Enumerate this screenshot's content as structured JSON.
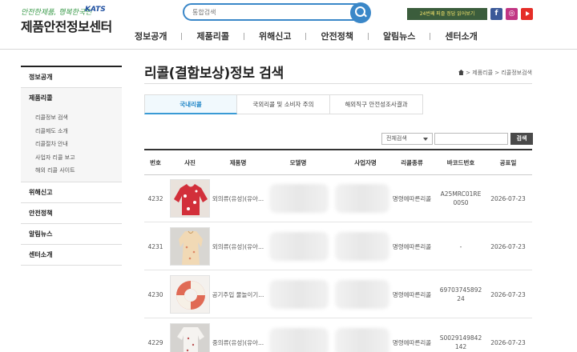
{
  "header": {
    "slogan": "안전한제품, 행복한국민",
    "kats_logo": "KATS",
    "site_title": "제품안전정보센터",
    "search_placeholder": "통합검색",
    "banner_text": "24번째 퍼즐 정답 읽어보기",
    "sns": [
      {
        "name": "facebook-icon"
      },
      {
        "name": "instagram-icon"
      },
      {
        "name": "youtube-icon"
      }
    ]
  },
  "gnb": [
    "정보공개",
    "제품리콜",
    "위해신고",
    "안전정책",
    "알림뉴스",
    "센터소개"
  ],
  "lnb": {
    "menus": [
      "정보공개",
      "제품리콜",
      "위해신고",
      "안전정책",
      "알림뉴스",
      "센터소개"
    ],
    "active": "제품리콜",
    "sub": [
      "리콜정보 검색",
      "리콜제도 소개",
      "리콜절차 안내",
      "사업자 리콜 보고",
      "해외 리콜 사이트"
    ]
  },
  "page_title": "리콜(결함보상)정보 검색",
  "breadcrumb": [
    "제품리콜",
    "리콜정보검색"
  ],
  "tabs": [
    "국내리콜",
    "국외리콜 및 소비자 주의",
    "해외직구 안전성조사결과"
  ],
  "active_tab": 0,
  "search": {
    "select_value": "전체검색",
    "button": "검색"
  },
  "table": {
    "headers": [
      "번호",
      "사진",
      "제품명",
      "모델명",
      "사업자명",
      "리콜종류",
      "바코드번호",
      "공표일"
    ],
    "rows": [
      {
        "no": "4232",
        "product": "외의류(유성)(유아...",
        "recall_type": "명령에따른리콜",
        "barcode": [
          "A25MRC01RE",
          "00S0"
        ],
        "date": "2026-07-23"
      },
      {
        "no": "4231",
        "product": "외의류(유성)(유아...",
        "recall_type": "명령에따른리콜",
        "barcode": [
          "-"
        ],
        "date": "2026-07-23"
      },
      {
        "no": "4230",
        "product": "공기주입 물놀이기...",
        "recall_type": "명령에따른리콜",
        "barcode": [
          "69703745892",
          "24"
        ],
        "date": "2026-07-23"
      },
      {
        "no": "4229",
        "product": "중의류(유성)(유아...",
        "recall_type": "명령에따른리콜",
        "barcode": [
          "S0029149842",
          "142"
        ],
        "date": "2026-07-23"
      }
    ]
  },
  "colors": {
    "accent": "#3a87c8",
    "tab_active": "#1c84c6",
    "button_dark": "#4a4a4a"
  }
}
